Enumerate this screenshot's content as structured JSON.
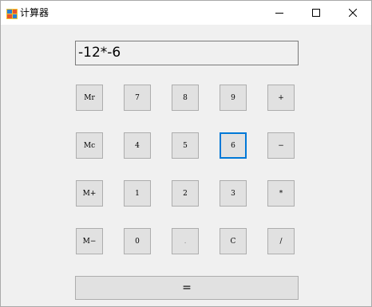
{
  "window": {
    "title": "计算器"
  },
  "display": {
    "value": "-12*-6"
  },
  "keys": {
    "mr": "Mr",
    "n7": "7",
    "n8": "8",
    "n9": "9",
    "plus": "+",
    "mc": "Mc",
    "n4": "4",
    "n5": "5",
    "n6": "6",
    "minus": "−",
    "mplus": "M+",
    "n1": "1",
    "n2": "2",
    "n3": "3",
    "mul": "*",
    "mminus": "M−",
    "n0": "0",
    "dot": ".",
    "clear": "C",
    "div": "/",
    "equals": "="
  },
  "icons": {
    "app": "calculator-app-icon",
    "minimize": "minimize-icon",
    "maximize": "maximize-icon",
    "close": "close-icon"
  },
  "colors": {
    "focus": "#0078d7",
    "button_face": "#e1e1e1",
    "window_bg": "#f0f0f0"
  }
}
